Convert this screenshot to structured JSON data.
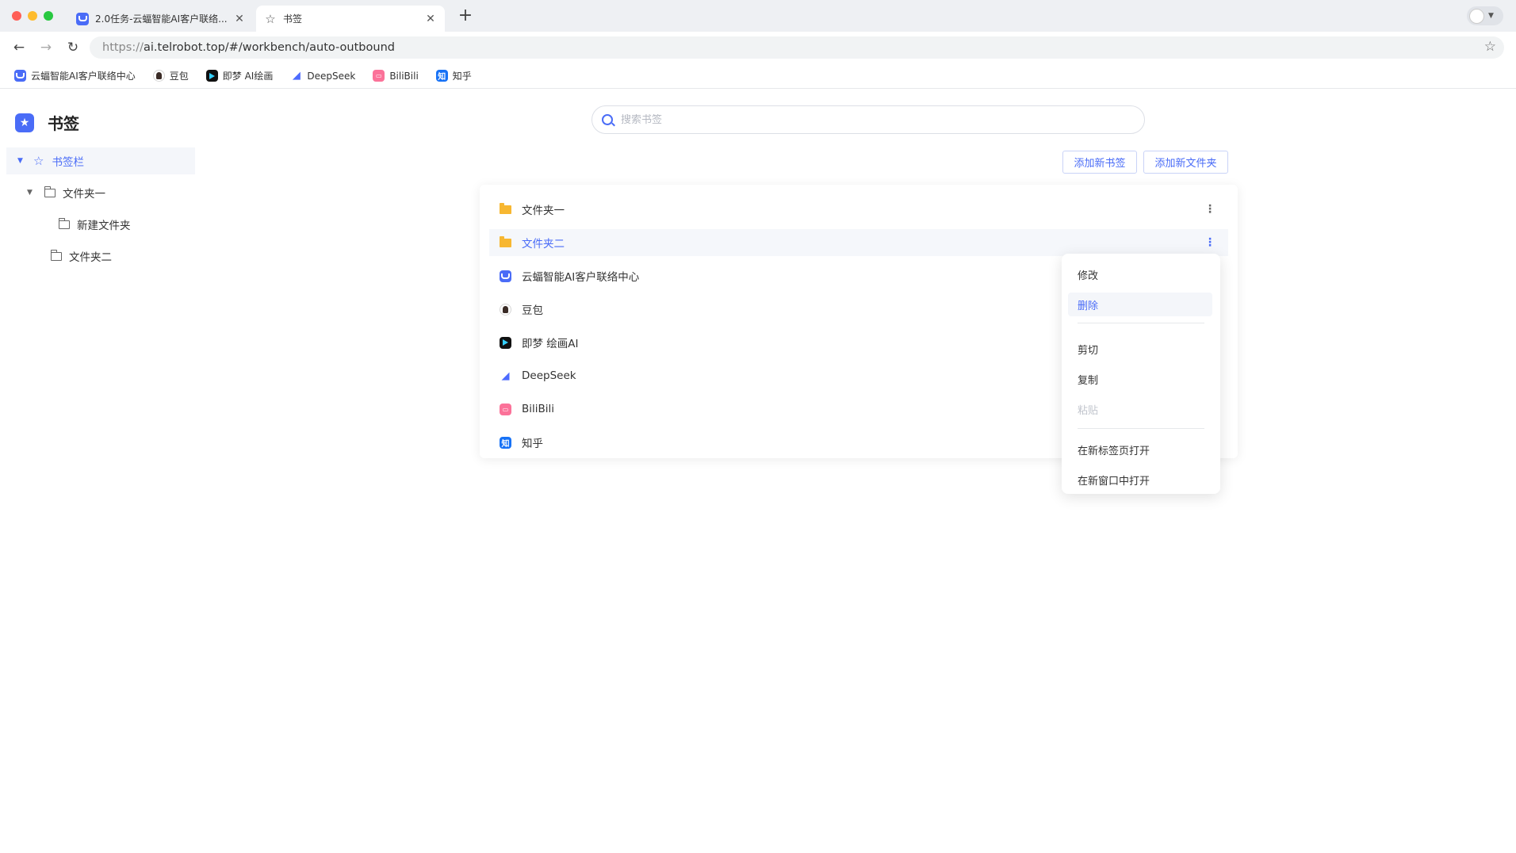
{
  "browser": {
    "tabs": [
      {
        "title": "2.0任务-云蝠智能AI客户联络...",
        "favicon": "yunfu-icon",
        "active": false
      },
      {
        "title": "书签",
        "favicon": "star-icon",
        "active": true
      }
    ],
    "address": {
      "scheme": "https://",
      "host_path": "ai.telrobot.top/#/workbench/auto-outbound"
    },
    "bookmarks_bar": [
      {
        "label": "云蝠智能AI客户联络中心",
        "icon": "yunfu-icon"
      },
      {
        "label": "豆包",
        "icon": "doubao-icon"
      },
      {
        "label": "即梦 AI绘画",
        "icon": "jimeng-icon"
      },
      {
        "label": "DeepSeek",
        "icon": "deepseek-icon"
      },
      {
        "label": "BiliBili",
        "icon": "bilibili-icon"
      },
      {
        "label": "知乎",
        "icon": "zhihu-icon"
      }
    ]
  },
  "sidebar": {
    "title": "书签",
    "tree": [
      {
        "label": "书签栏",
        "expanded": true,
        "selected": true
      },
      {
        "label": "文件夹一",
        "expanded": true
      },
      {
        "label": "新建文件夹"
      },
      {
        "label": "文件夹二"
      }
    ]
  },
  "search": {
    "placeholder": "搜索书签",
    "value": ""
  },
  "actions": {
    "add_bookmark": "添加新书签",
    "add_folder": "添加新文件夹"
  },
  "list": [
    {
      "label": "文件夹一",
      "type": "folder"
    },
    {
      "label": "文件夹二",
      "type": "folder",
      "hovered": true
    },
    {
      "label": "云蝠智能AI客户联络中心",
      "icon": "yunfu-icon"
    },
    {
      "label": "豆包",
      "icon": "doubao-icon"
    },
    {
      "label": "即梦 绘画AI",
      "icon": "jimeng-icon"
    },
    {
      "label": "DeepSeek",
      "icon": "deepseek-icon"
    },
    {
      "label": "BiliBili",
      "icon": "bilibili-icon"
    },
    {
      "label": "知乎",
      "icon": "zhihu-icon"
    }
  ],
  "context_menu": {
    "items": [
      {
        "label": "修改"
      },
      {
        "label": "删除",
        "active": true
      },
      {
        "label": "剪切"
      },
      {
        "label": "复制"
      },
      {
        "label": "粘贴",
        "disabled": true
      },
      {
        "label": "在新标签页打开"
      },
      {
        "label": "在新窗口中打开"
      }
    ]
  },
  "colors": {
    "accent": "#4a6cf7",
    "folder": "#f7b731"
  }
}
